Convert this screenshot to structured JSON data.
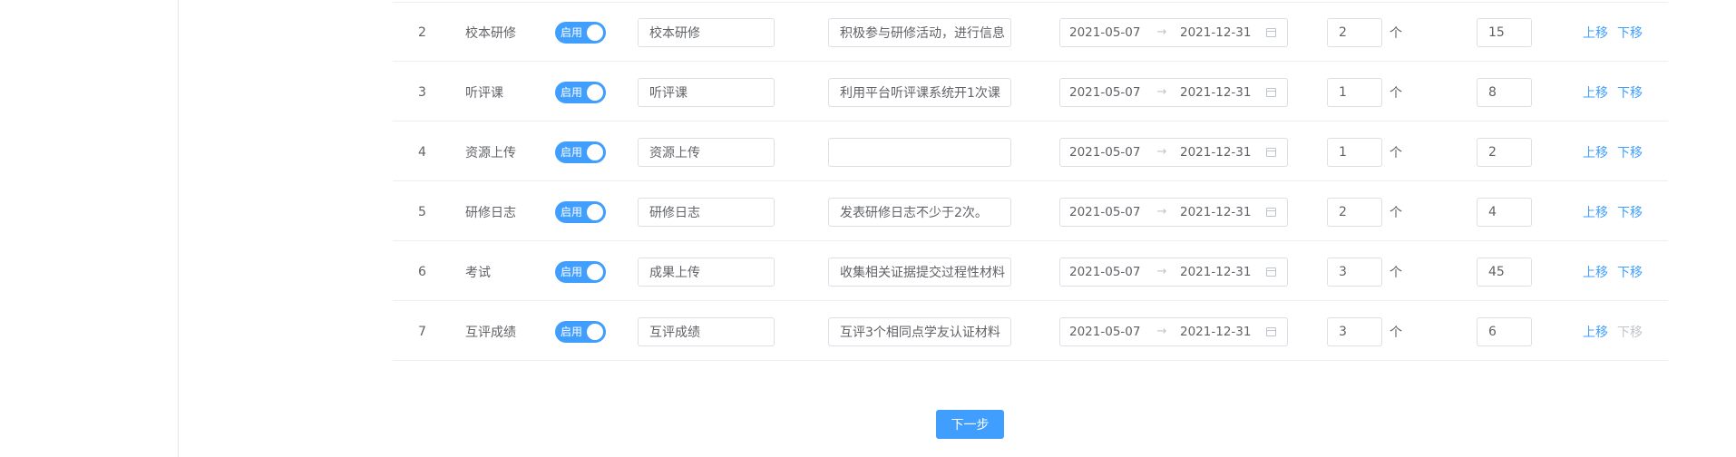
{
  "rows": [
    {
      "index": "2",
      "name": "校本研修",
      "switch_label": "启用",
      "title_value": "校本研修",
      "desc_value": "积极参与研修活动，进行信息",
      "date_start": "2021-05-07",
      "date_end": "2021-12-31",
      "date_sep": "→",
      "count": "2",
      "unit": "个",
      "score": "15",
      "up_label": "上移",
      "down_label": "下移",
      "down_enabled": true
    },
    {
      "index": "3",
      "name": "听评课",
      "switch_label": "启用",
      "title_value": "听评课",
      "desc_value": "利用平台听评课系统开1次课",
      "date_start": "2021-05-07",
      "date_end": "2021-12-31",
      "date_sep": "→",
      "count": "1",
      "unit": "个",
      "score": "8",
      "up_label": "上移",
      "down_label": "下移",
      "down_enabled": true
    },
    {
      "index": "4",
      "name": "资源上传",
      "switch_label": "启用",
      "title_value": "资源上传",
      "desc_value": "",
      "date_start": "2021-05-07",
      "date_end": "2021-12-31",
      "date_sep": "→",
      "count": "1",
      "unit": "个",
      "score": "2",
      "up_label": "上移",
      "down_label": "下移",
      "down_enabled": true
    },
    {
      "index": "5",
      "name": "研修日志",
      "switch_label": "启用",
      "title_value": "研修日志",
      "desc_value": "发表研修日志不少于2次。",
      "date_start": "2021-05-07",
      "date_end": "2021-12-31",
      "date_sep": "→",
      "count": "2",
      "unit": "个",
      "score": "4",
      "up_label": "上移",
      "down_label": "下移",
      "down_enabled": true
    },
    {
      "index": "6",
      "name": "考试",
      "switch_label": "启用",
      "title_value": "成果上传",
      "desc_value": "收集相关证据提交过程性材料",
      "date_start": "2021-05-07",
      "date_end": "2021-12-31",
      "date_sep": "→",
      "count": "3",
      "unit": "个",
      "score": "45",
      "up_label": "上移",
      "down_label": "下移",
      "down_enabled": true
    },
    {
      "index": "7",
      "name": "互评成绩",
      "switch_label": "启用",
      "title_value": "互评成绩",
      "desc_value": "互评3个相同点学友认证材料",
      "date_start": "2021-05-07",
      "date_end": "2021-12-31",
      "date_sep": "→",
      "count": "3",
      "unit": "个",
      "score": "6",
      "up_label": "上移",
      "down_label": "下移",
      "down_enabled": false
    }
  ],
  "footer": {
    "next_label": "下一步"
  },
  "colors": {
    "primary": "#409eff",
    "disabled": "#c0c4cc",
    "border": "#dcdfe6"
  }
}
